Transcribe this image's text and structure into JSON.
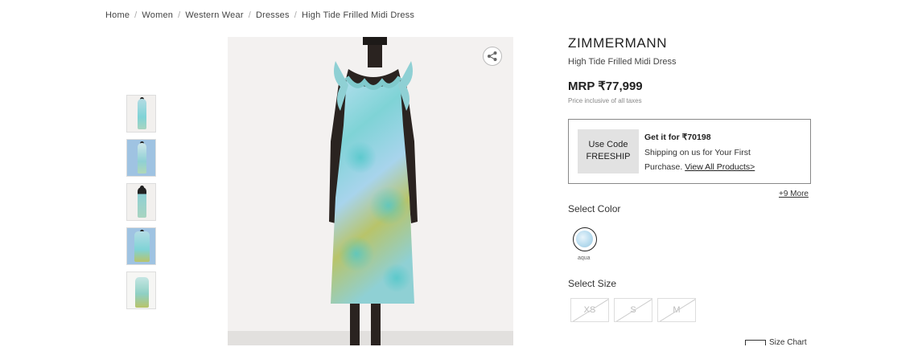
{
  "breadcrumb": [
    "Home",
    "Women",
    "Western Wear",
    "Dresses",
    "High Tide Frilled Midi Dress"
  ],
  "product": {
    "brand": "ZIMMERMANN",
    "name": "High Tide Frilled Midi Dress",
    "price": "MRP ₹77,999",
    "tax_note": "Price inclusive of all taxes"
  },
  "offer": {
    "coupon_line1": "Use Code",
    "coupon_line2": "FREESHIP",
    "title": "Get it for ₹70198",
    "description": "Shipping on us for Your First Purchase.",
    "link": "View All Products>",
    "more": "+9 More"
  },
  "color": {
    "heading": "Select Color",
    "selected": "aqua"
  },
  "sizes": {
    "heading": "Select Size",
    "options": [
      "XS",
      "S",
      "M"
    ],
    "chart_label": "Size Chart"
  },
  "colors": {
    "dress_aqua": "#7fd3d6",
    "dress_blue": "#a8d4ec",
    "dress_olive": "#b8c46a",
    "thumb_bg_blue": "#9fc3e2"
  }
}
